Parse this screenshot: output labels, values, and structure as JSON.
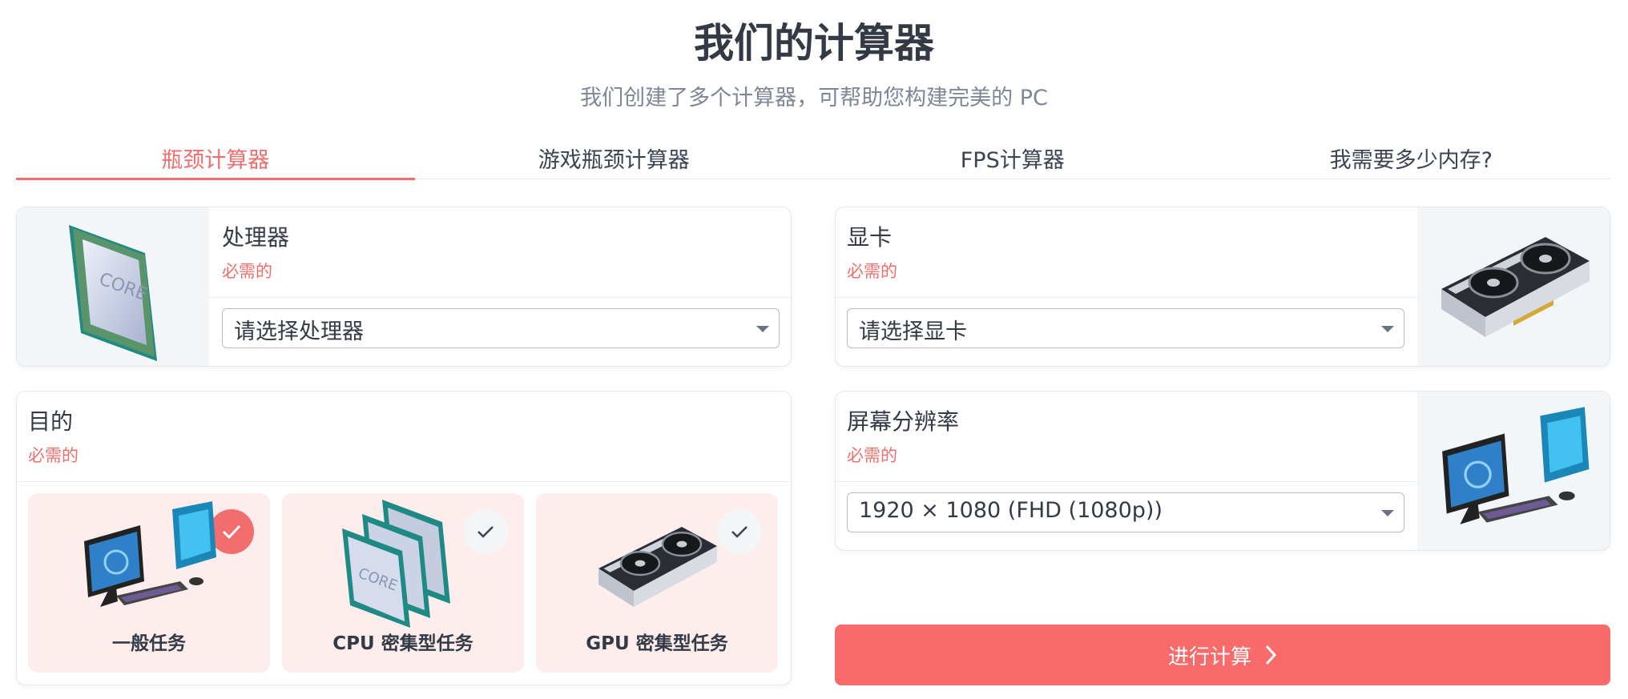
{
  "header": {
    "title": "我们的计算器",
    "subtitle": "我们创建了多个计算器，可帮助您构建完美的 PC"
  },
  "tabs": [
    {
      "label": "瓶颈计算器",
      "active": true
    },
    {
      "label": "游戏瓶颈计算器",
      "active": false
    },
    {
      "label": "FPS计算器",
      "active": false
    },
    {
      "label": "我需要多少内存?",
      "active": false
    }
  ],
  "processor": {
    "label": "处理器",
    "required": "必需的",
    "placeholder": "请选择处理器",
    "image_icon": "cpu-chip-icon"
  },
  "gpu": {
    "label": "显卡",
    "required": "必需的",
    "placeholder": "请选择显卡",
    "image_icon": "graphics-card-icon"
  },
  "purpose": {
    "label": "目的",
    "required": "必需的",
    "options": [
      {
        "label": "一般任务",
        "selected": true,
        "icon": "desktop-pc-icon"
      },
      {
        "label": "CPU 密集型任务",
        "selected": false,
        "icon": "cpu-stack-icon"
      },
      {
        "label": "GPU 密集型任务",
        "selected": false,
        "icon": "graphics-card-icon"
      }
    ]
  },
  "resolution": {
    "label": "屏幕分辨率",
    "required": "必需的",
    "value": "1920 × 1080 (FHD (1080p))",
    "image_icon": "desktop-pc-icon"
  },
  "submit": {
    "label": "进行计算"
  },
  "colors": {
    "accent": "#f26d6d",
    "button": "#f96a6a",
    "option_bg": "#fdeeed",
    "text": "#333a45",
    "muted": "#7d8795"
  }
}
